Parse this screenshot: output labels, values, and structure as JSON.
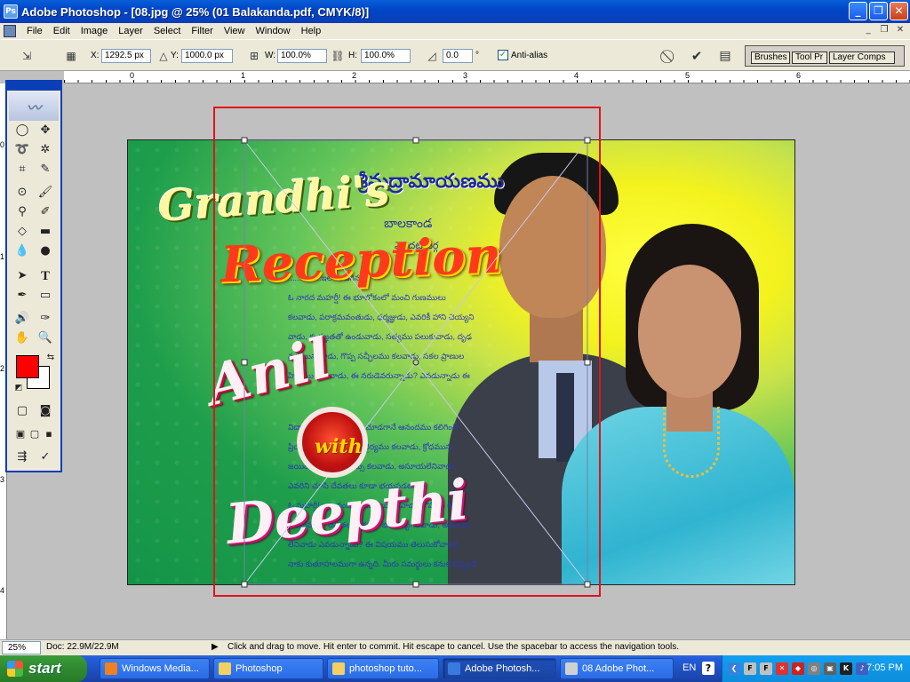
{
  "window": {
    "title": "Adobe Photoshop - [08.jpg @ 25% (01 Balakanda.pdf, CMYK/8)]",
    "icon": "ps-app-icon",
    "controls": [
      "_",
      "❐",
      "✕"
    ]
  },
  "menu": {
    "items": [
      "File",
      "Edit",
      "Image",
      "Layer",
      "Select",
      "Filter",
      "View",
      "Window",
      "Help"
    ],
    "mdi_controls": [
      "_",
      "❐",
      "✕"
    ]
  },
  "options": {
    "x_label": "X:",
    "x_value": "1292.5 px",
    "y_label": "Y:",
    "y_value": "1000.0 px",
    "w_label": "W:",
    "w_value": "100.0%",
    "h_label": "H:",
    "h_value": "100.0%",
    "angle_value": "0.0",
    "angle_unit": "°",
    "antialias_label": "Anti-alias",
    "antialias_checked": true,
    "palette_well_tabs": [
      "Brushes",
      "Tool Pr",
      "Layer Comps"
    ]
  },
  "rulers": {
    "top_numbers": [
      "0",
      "1",
      "2",
      "3",
      "4",
      "5",
      "6"
    ],
    "left_numbers": [
      "0",
      "1",
      "2",
      "3",
      "4"
    ]
  },
  "artwork": {
    "grandhi": "Grandhi's",
    "reception": "Reception",
    "anil": "Anil",
    "with": "with",
    "deepthi": "Deepthi",
    "telugu_heading": "శ్రీమద్రామాయణము",
    "telugu_sub": "బాలకాండ",
    "telugu_sub2": "మొదటి సర్గ",
    "para1": [
      "...............ఇలా అడిగెను.",
      "ఓ నారద మహర్షీ! ఈ భూలోకంలో మంచి గుణములు",
      "కలవాడు, పరాక్రమవంతుడు, ధర్మజ్ఞుడు, ఎవరికీ హాని చెయ్యని",
      "వాడు, కృతజ్ఞతతో ఉండువాడు, సత్యము పలుకువాడు, దృఢ",
      "వ్రతమున్నవాడు, గొప్ప సచ్ఛీలము కలవాడు, సకల ప్రాణుల",
      "హితము కోరువాడు, ఈ నరుడెవరున్నాడు? ఎవడున్నాడు ఈ"
    ],
    "para2": [
      "విద్యాంసుడు, సమర్థుడు, చూడగానే ఆనందము కలిగించే",
      "ప్రియదర్శనుడు, శ్రేష్ఠుడు, ధైర్యము కలవాడు, క్రోధమును",
      "జయించినవాడు, తేజస్సు కలవాడు, అసూయలేనివాడు,",
      "ఎవరిని చూసి దేవతలు కూడా భయపడతారో?"
    ],
    "para3": [
      "ఓ మహర్షీ! ఇటువంటి గుణములు కలవాడు, కోపము కలిగి",
      "యుద్ధములో దేవతలను కూడా భయపెట్టగలవాడు, అనూయ",
      "లేనివాడు ఎవడున్నాడు? ఈ విషయము తెలుసుకోవాలని",
      "నాకు కుతూహలముగా ఉన్నది. మీరు సమర్థులు కనుక చెప్పండి"
    ]
  },
  "status": {
    "zoom": "25%",
    "doc": "Doc: 22.9M/22.9M",
    "hint": "Click and drag to move. Hit enter to commit. Hit escape to cancel. Use the spacebar to access the navigation tools."
  },
  "taskbar": {
    "start_label": "start",
    "tasks": [
      {
        "label": "Windows Media...",
        "icon": "media-player-icon",
        "color": "#f08020"
      },
      {
        "label": "Photoshop",
        "icon": "folder-icon",
        "color": "#f4d060"
      },
      {
        "label": "photoshop tuto...",
        "icon": "folder-icon",
        "color": "#f4d060"
      },
      {
        "label": "Adobe Photosh...",
        "icon": "photoshop-icon",
        "color": "#3a7ae0"
      },
      {
        "label": "08 Adobe Phot...",
        "icon": "document-icon",
        "color": "#d0d0d0"
      }
    ],
    "lang": "EN",
    "help": "?",
    "clock": "7:05 PM"
  }
}
